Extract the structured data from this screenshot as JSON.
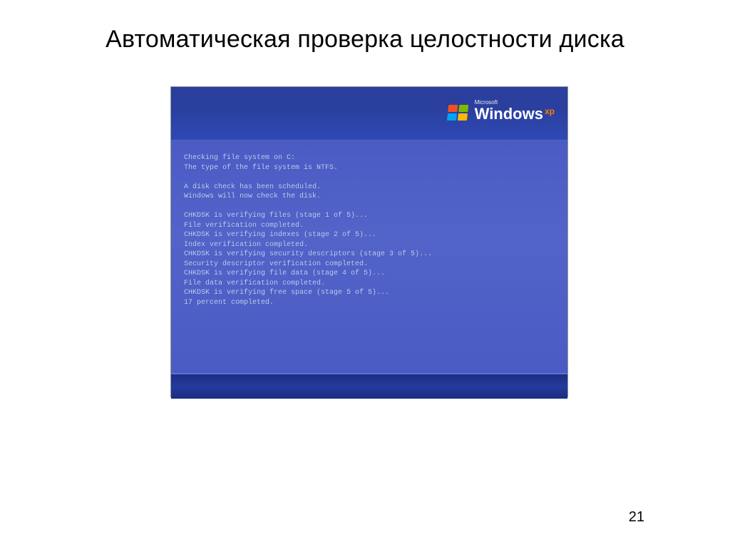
{
  "slide": {
    "title": "Автоматическая проверка целостности диска",
    "page_number": "21"
  },
  "branding": {
    "company": "Microsoft",
    "product": "Windows",
    "edition": "xp"
  },
  "chkdsk": {
    "lines": [
      "Checking file system on C:",
      "The type of the file system is NTFS.",
      "",
      "A disk check has been scheduled.",
      "Windows will now check the disk.",
      "",
      "CHKDSK is verifying files (stage 1 of 5)...",
      "File verification completed.",
      "CHKDSK is verifying indexes (stage 2 of 5)...",
      "Index verification completed.",
      "CHKDSK is verifying security descriptors (stage 3 of 5)...",
      "Security descriptor verification completed.",
      "CHKDSK is verifying file data (stage 4 of 5)...",
      "File data verification completed.",
      "CHKDSK is verifying free space (stage 5 of 5)...",
      "17 percent completed."
    ]
  }
}
